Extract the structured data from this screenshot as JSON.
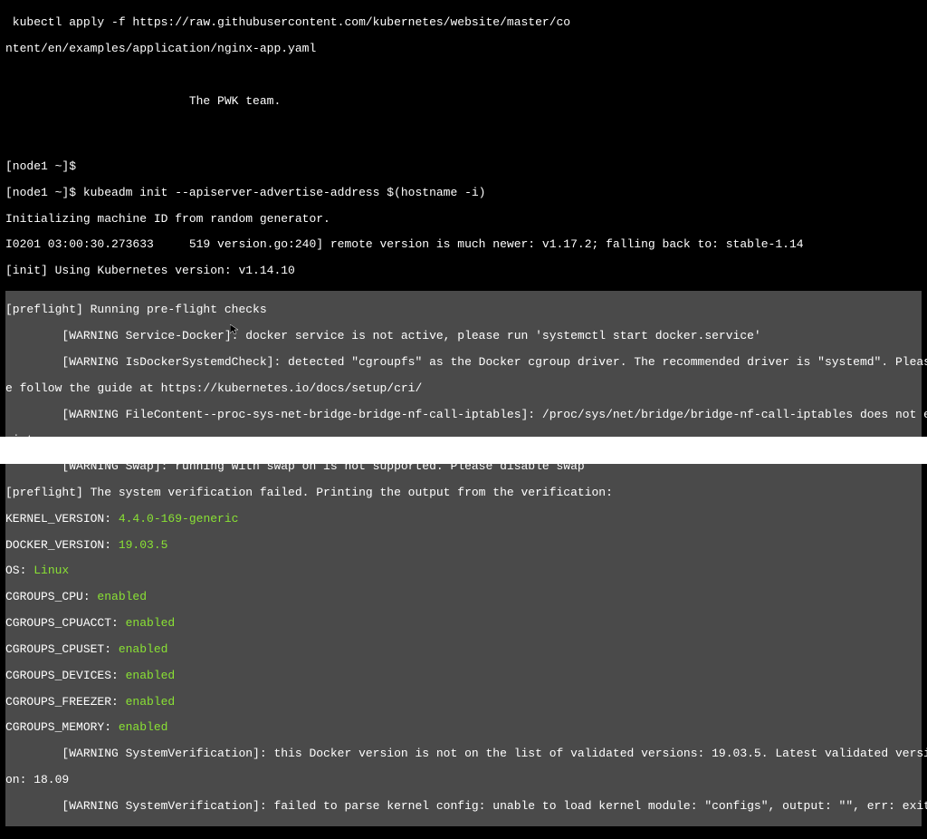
{
  "lines": {
    "l1": " kubectl apply -f https://raw.githubusercontent.com/kubernetes/website/master/co",
    "l2": "ntent/en/examples/application/nginx-app.yaml",
    "l3": "",
    "l4": "",
    "l5": "                          The PWK team.",
    "l6": "",
    "l7": "",
    "l8": "",
    "l9": "[node1 ~]$",
    "l10": "[node1 ~]$ kubeadm init --apiserver-advertise-address $(hostname -i)",
    "l11": "Initializing machine ID from random generator.",
    "l12": "I0201 03:00:30.273633     519 version.go:240] remote version is much newer: v1.17.2; falling back to: stable-1.14",
    "l13": "[init] Using Kubernetes version: v1.14.10",
    "l14": "[preflight] Running pre-flight checks",
    "l15": "        [WARNING Service-Docker]: docker service is not active, please run 'systemctl start docker.service'",
    "l16": "        [WARNING IsDockerSystemdCheck]: detected \"cgroupfs\" as the Docker cgroup driver. The recommended driver is \"systemd\". Pleas",
    "l17": "e follow the guide at https://kubernetes.io/docs/setup/cri/",
    "l18": "        [WARNING FileContent--proc-sys-net-bridge-bridge-nf-call-iptables]: /proc/sys/net/bridge/bridge-nf-call-iptables does not e",
    "l19": "xist",
    "l20": "        [WARNING Swap]: running with swap on is not supported. Please disable swap",
    "l21": "[preflight] The system verification failed. Printing the output from the verification:",
    "kv1_key": "KERNEL_VERSION: ",
    "kv1_val": "4.4.0-169-generic",
    "kv2_key": "DOCKER_VERSION: ",
    "kv2_val": "19.03.5",
    "kv3_key": "OS: ",
    "kv3_val": "Linux",
    "kv4_key": "CGROUPS_CPU: ",
    "kv4_val": "enabled",
    "kv5_key": "CGROUPS_CPUACCT: ",
    "kv5_val": "enabled",
    "kv6_key": "CGROUPS_CPUSET: ",
    "kv6_val": "enabled",
    "kv7_key": "CGROUPS_DEVICES: ",
    "kv7_val": "enabled",
    "kv8_key": "CGROUPS_FREEZER: ",
    "kv8_val": "enabled",
    "kv9_key": "CGROUPS_MEMORY: ",
    "kv9_val": "enabled",
    "l31": "        [WARNING SystemVerification]: this Docker version is not on the list of validated versions: 19.03.5. Latest validated versi",
    "l32": "on: 18.09",
    "l33": "        [WARNING SystemVerification]: failed to parse kernel config: unable to load kernel module: \"configs\", output: \"\", err: exit"
  }
}
